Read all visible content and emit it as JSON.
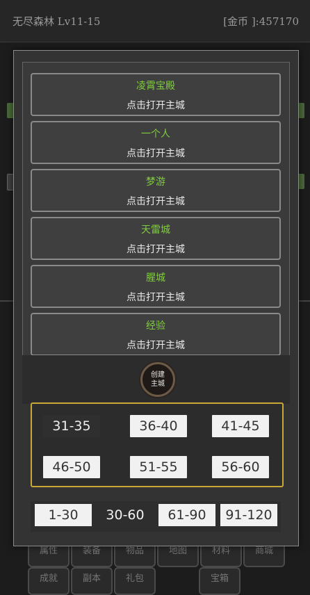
{
  "header": {
    "map_name": "无尽森林 Lv11-15",
    "gold": "[金币 ]:457170"
  },
  "modal": {
    "cities": [
      {
        "name": "凌霄宝殿",
        "action": "点击打开主城"
      },
      {
        "name": "一个人",
        "action": "点击打开主城"
      },
      {
        "name": "梦游",
        "action": "点击打开主城"
      },
      {
        "name": "天雷城",
        "action": "点击打开主城"
      },
      {
        "name": "腥城",
        "action": "点击打开主城"
      },
      {
        "name": "经验",
        "action": "点击打开主城"
      }
    ],
    "create_label_line1": "创建",
    "create_label_line2": "主城",
    "level_ranges": [
      "31-35",
      "36-40",
      "41-45",
      "46-50",
      "51-55",
      "56-60"
    ],
    "active_range": "31-35",
    "tiers": [
      "1-30",
      "30-60",
      "61-90",
      "91-120"
    ],
    "active_tier": "30-60"
  },
  "bottom_nav": [
    "属性",
    "装备",
    "物品",
    "地图",
    "材料",
    "商城",
    "成就",
    "副本",
    "礼包",
    "宝箱"
  ],
  "colors": {
    "city_name": "#7fcc3d",
    "range_border": "#c9a838"
  }
}
